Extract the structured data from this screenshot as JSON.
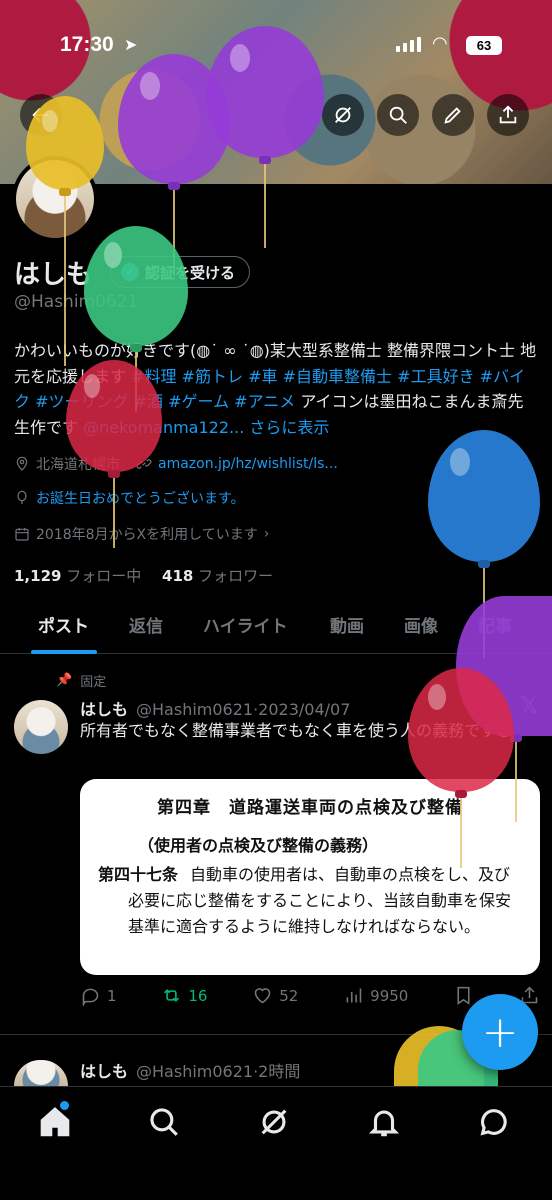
{
  "status_bar": {
    "time": "17:30",
    "battery": "63"
  },
  "profile": {
    "name": "はしも",
    "verify_label": "認証を受ける",
    "handle": "@Hashim0621",
    "bio": {
      "p1": "かわいいものが好きです(◍˙ ∞ ˙◍)某大型系整備士 整備界隈コント士 地元を応援します ",
      "tags": [
        "#料理",
        "#筋トレ",
        "#車",
        "#自動車整備士",
        "#工具好き",
        "#バイク",
        "#ツーリング",
        "#酒",
        "#ゲーム",
        "#アニメ"
      ],
      "p2": " アイコンは墨田ねこまんま斎先生作です ",
      "mention": "@nekomanma122...",
      "more": "さらに表示"
    },
    "location": "北海道札幌市",
    "website": "amazon.jp/hz/wishlist/ls...",
    "birthday": "お誕生日おめでとうございます。",
    "joined": "2018年8月からXを利用しています",
    "following_count": "1,129",
    "following_label": "フォロー中",
    "followers_count": "418",
    "followers_label": "フォロワー"
  },
  "tabs": [
    "ポスト",
    "返信",
    "ハイライト",
    "動画",
    "画像",
    "記事"
  ],
  "pinned_label": "固定",
  "tweet1": {
    "name": "はしも",
    "handle": "@Hashim0621",
    "date": "2023/04/07",
    "text": "所有者でもなく整備事業者でもなく車を使う人の義務です😉",
    "card": {
      "title": "第四章　道路運送車両の点検及び整備",
      "subtitle": "（使用者の点検及び整備の義務）",
      "article": "第四十七条",
      "body": "自動車の使用者は、自動車の点検をし、及び必要に応じ整備をすることにより、当該自動車を保安基準に適合するように維持しなければならない。"
    },
    "replies": "1",
    "reposts": "16",
    "likes": "52",
    "views": "9950"
  },
  "tweet2": {
    "name": "はしも",
    "handle": "@Hashim0621",
    "date": "2時間"
  },
  "colors": {
    "accent": "#1d9bf0",
    "repost": "#00ba7c",
    "muted": "#71767b",
    "background": "#000000"
  },
  "icons": [
    "back-arrow-icon",
    "grok-icon",
    "search-icon",
    "pencil-icon",
    "share-icon",
    "home-icon",
    "explore-icon",
    "grok-nav-icon",
    "bell-icon",
    "messages-icon"
  ]
}
